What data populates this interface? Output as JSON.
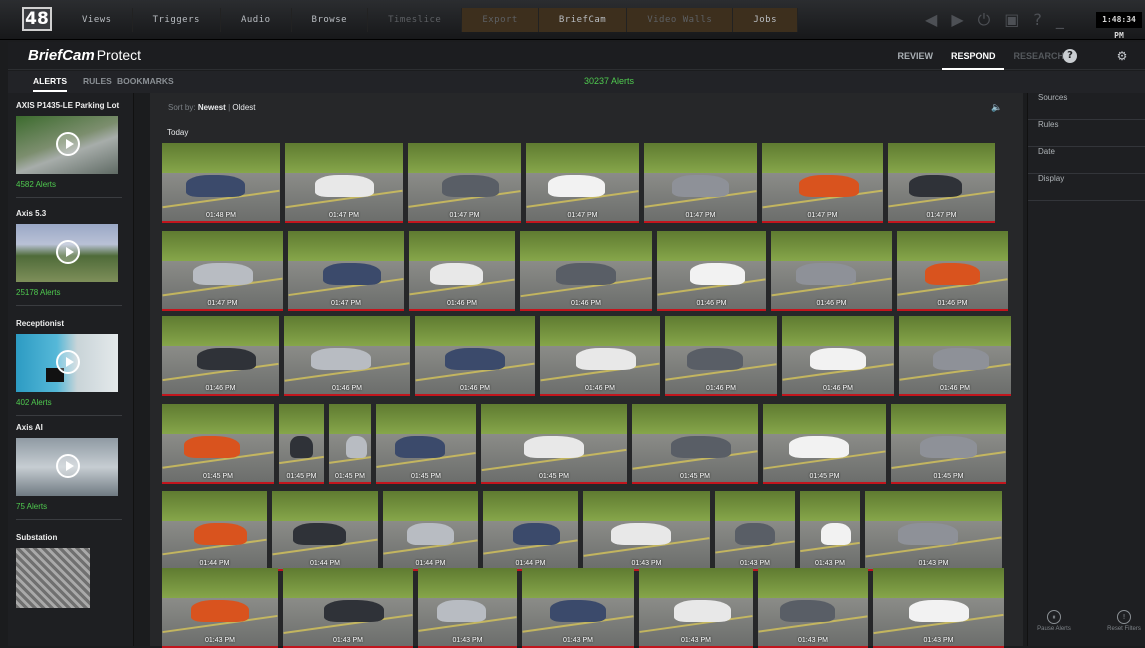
{
  "os_bar": {
    "logo_text": "48",
    "menu": [
      "Views",
      "Triggers",
      "Audio",
      "Browse",
      "Timeslice",
      "Export",
      "BriefCam",
      "Video Walls",
      "Jobs"
    ],
    "clock": "1:48:34 PM"
  },
  "app": {
    "brand": "BriefCam",
    "brand_sub": "Protect",
    "modes": [
      "REVIEW",
      "RESPOND",
      "RESEARCH"
    ],
    "active_mode": "RESPOND"
  },
  "subtabs": {
    "items": [
      "ALERTS",
      "RULES",
      "BOOKMARKS"
    ],
    "active": "ALERTS",
    "alert_count": "30237 Alerts"
  },
  "cameras": [
    {
      "title": "AXIS P1435-LE Parking Lot",
      "count": "4582 Alerts"
    },
    {
      "title": "Axis 5.3",
      "count": "25178 Alerts"
    },
    {
      "title": "Receptionist",
      "count": "402 Alerts"
    },
    {
      "title": "Axis AI",
      "count": "75 Alerts"
    },
    {
      "title": "Substation",
      "count": ""
    }
  ],
  "sort": {
    "label": "Sort by:",
    "newest": "Newest",
    "sep": "|",
    "oldest": "Oldest"
  },
  "day_label": "Today",
  "rows": [
    [
      "01:48 PM",
      "01:47 PM",
      "01:47 PM",
      "01:47 PM",
      "01:47 PM",
      "01:47 PM",
      "01:47 PM"
    ],
    [
      "01:47 PM",
      "01:47 PM",
      "01:46 PM",
      "01:46 PM",
      "01:46 PM",
      "01:46 PM",
      "01:46 PM"
    ],
    [
      "01:46 PM",
      "01:46 PM",
      "01:46 PM",
      "01:46 PM",
      "01:46 PM",
      "01:46 PM",
      "01:46 PM"
    ],
    [
      "01:45 PM",
      "01:45 PM",
      "01:45 PM",
      "01:45 PM",
      "01:45 PM",
      "01:45 PM",
      "01:45 PM",
      "01:45 PM"
    ],
    [
      "01:44 PM",
      "01:44 PM",
      "01:44 PM",
      "01:44 PM",
      "01:43 PM",
      "01:43 PM",
      "01:43 PM",
      "01:43 PM"
    ],
    [
      "01:43 PM",
      "01:43 PM",
      "01:43 PM",
      "01:43 PM",
      "01:43 PM",
      "01:43 PM",
      "01:43 PM"
    ]
  ],
  "filters": [
    "Sources",
    "Rules",
    "Date",
    "Display"
  ],
  "footer_buttons": [
    "Pause Alerts",
    "Reset Filters"
  ],
  "colors": {
    "accent_green": "#4fca4f",
    "alert_underline": "#c2151d"
  },
  "icons": {
    "help": "help-icon",
    "settings": "gear-icon",
    "mute": "speaker-mute-icon"
  }
}
